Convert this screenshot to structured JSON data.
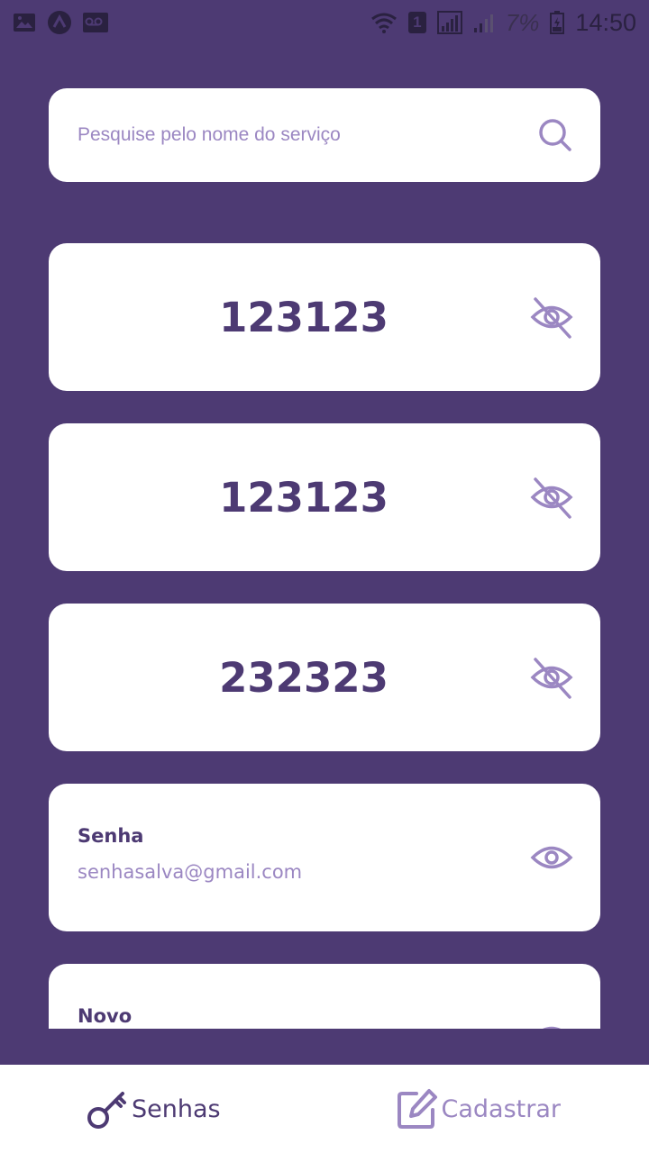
{
  "status_bar": {
    "signal_badge": "1",
    "battery_percent": "7%",
    "time": "14:50"
  },
  "search": {
    "placeholder": "Pesquise pelo nome do serviço",
    "value": ""
  },
  "items": [
    {
      "type": "password_shown",
      "value": "123123"
    },
    {
      "type": "password_shown",
      "value": "123123"
    },
    {
      "type": "password_shown",
      "value": "232323"
    },
    {
      "type": "service",
      "title": "Senha",
      "email": "senhasalva@gmail.com"
    },
    {
      "type": "service",
      "title": "Novo",
      "email": ""
    }
  ],
  "tabs": [
    {
      "label": "Senhas",
      "icon": "key-icon",
      "active": true
    },
    {
      "label": "Cadastrar",
      "icon": "edit-icon",
      "active": false
    }
  ],
  "colors": {
    "background": "#4d3a73",
    "accent": "#9b87c2",
    "card": "#ffffff"
  }
}
